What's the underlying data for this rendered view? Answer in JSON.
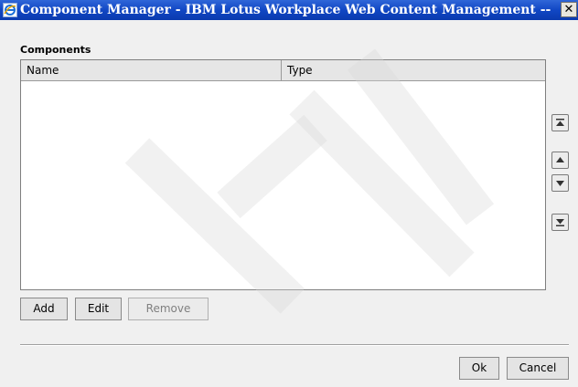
{
  "window": {
    "title": "Component Manager - IBM Lotus Workplace Web Content Management -- Web...",
    "icon": "ie-browser-icon",
    "close_label": "✕"
  },
  "components": {
    "label": "Components",
    "columns": [
      "Name",
      "Type"
    ],
    "rows": []
  },
  "reorder_buttons": [
    {
      "name": "move-to-top-button",
      "icon": "move-top-icon"
    },
    {
      "name": "move-up-button",
      "icon": "move-up-icon"
    },
    {
      "name": "move-down-button",
      "icon": "move-down-icon"
    },
    {
      "name": "move-to-bottom-button",
      "icon": "move-bottom-icon"
    }
  ],
  "actions": {
    "add": "Add",
    "edit": "Edit",
    "remove": "Remove"
  },
  "dialog_buttons": {
    "ok": "Ok",
    "cancel": "Cancel"
  },
  "colors": {
    "titlebar": "#1147c4",
    "background": "#f0f0f0"
  }
}
